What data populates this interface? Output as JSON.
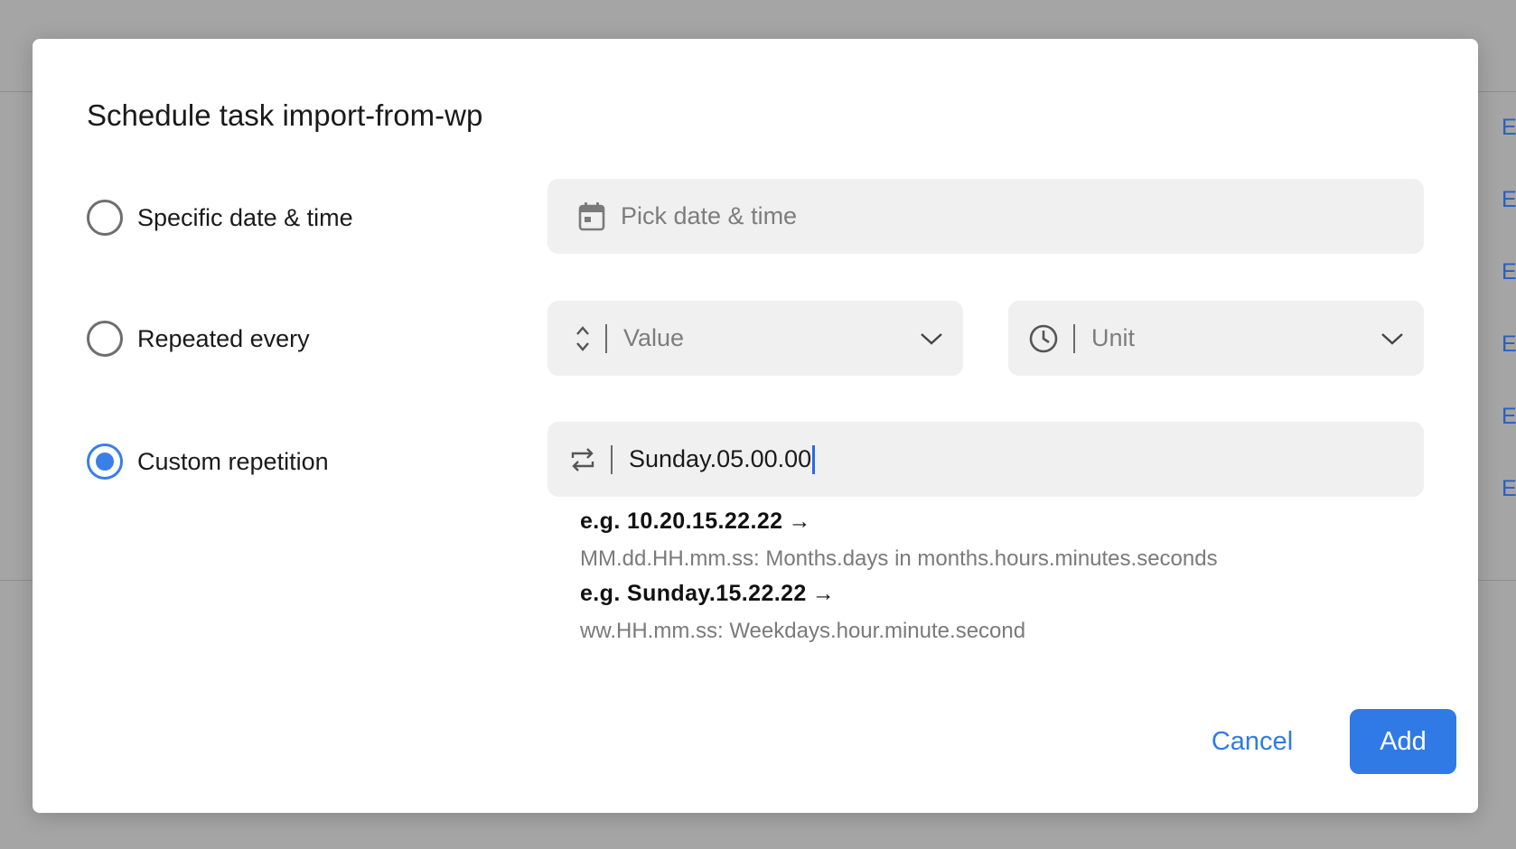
{
  "background": {
    "side_links": [
      "E",
      "E",
      "E",
      "E",
      "E",
      "E"
    ]
  },
  "dialog": {
    "title": "Schedule task import-from-wp",
    "options": {
      "specific": {
        "label": "Specific date & time",
        "checked": false
      },
      "repeated": {
        "label": "Repeated every",
        "checked": false
      },
      "custom": {
        "label": "Custom repetition",
        "checked": true
      }
    },
    "date_field": {
      "placeholder": "Pick date & time",
      "icon": "calendar-icon"
    },
    "value_select": {
      "placeholder": "Value",
      "icon": "sort-arrows-icon"
    },
    "unit_select": {
      "placeholder": "Unit",
      "icon": "clock-icon"
    },
    "custom_field": {
      "value": "Sunday.05.00.00",
      "icon": "repeat-icon"
    },
    "hints": [
      {
        "example": "e.g. 10.20.15.22.22",
        "arrow": "→",
        "description": "MM.dd.HH.mm.ss: Months.days in months.hours.minutes.seconds"
      },
      {
        "example": "e.g. Sunday.15.22.22",
        "arrow": "→",
        "description": "ww.HH.mm.ss: Weekdays.hour.minute.second"
      }
    ],
    "buttons": {
      "cancel": "Cancel",
      "add": "Add"
    },
    "colors": {
      "accent": "#2f7ae5",
      "field_bg": "#f0f0f0",
      "overlay": "#a5a5a5"
    }
  }
}
